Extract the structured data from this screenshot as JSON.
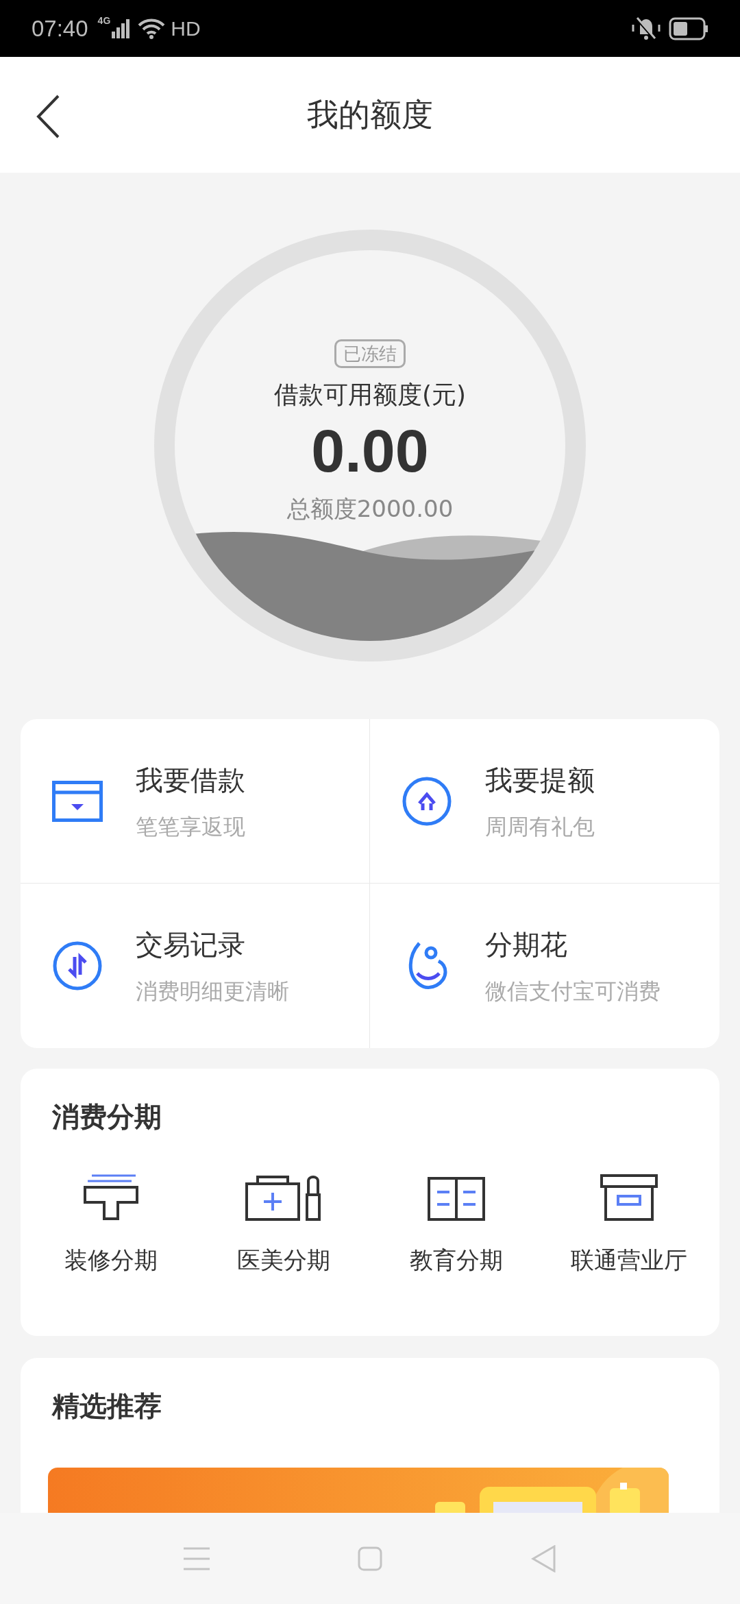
{
  "status_bar": {
    "time": "07:40",
    "network": "4G",
    "hd": "HD"
  },
  "header": {
    "title": "我的额度"
  },
  "quota": {
    "badge": "已冻结",
    "label": "借款可用额度(元)",
    "amount": "0.00",
    "total": "总额度2000.00"
  },
  "actions": [
    {
      "kind": "card",
      "title": "我要借款",
      "subtitle": "笔笔享返现"
    },
    {
      "kind": "upgrade",
      "title": "我要提额",
      "subtitle": "周周有礼包"
    },
    {
      "kind": "exchange",
      "title": "交易记录",
      "subtitle": "消费明细更清晰"
    },
    {
      "kind": "drop",
      "title": "分期花",
      "subtitle": "微信支付宝可消费"
    }
  ],
  "installments": {
    "title": "消费分期",
    "items": [
      {
        "kind": "renovation",
        "label": "装修分期"
      },
      {
        "kind": "medical",
        "label": "医美分期"
      },
      {
        "kind": "book",
        "label": "教育分期"
      },
      {
        "kind": "store",
        "label": "联通营业厅"
      }
    ]
  },
  "recommend": {
    "title": "精选推荐"
  }
}
